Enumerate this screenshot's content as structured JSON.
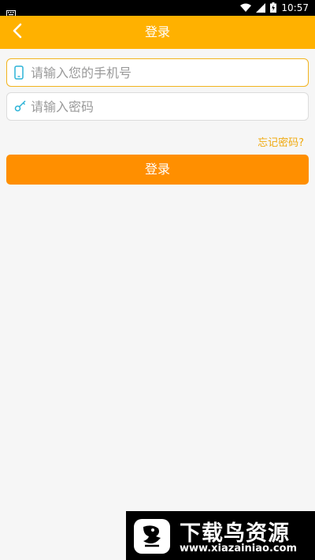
{
  "status_bar": {
    "time": "10:57",
    "icons": [
      "keyboard-icon",
      "wifi-icon",
      "signal-icon",
      "battery-charging-icon"
    ]
  },
  "app_bar": {
    "title": "登录",
    "back_icon": "chevron-left-icon"
  },
  "form": {
    "phone": {
      "placeholder": "请输入您的手机号",
      "value": "",
      "icon": "phone-icon",
      "focused": true
    },
    "password": {
      "placeholder": "请输入密码",
      "value": "",
      "icon": "key-icon"
    },
    "forgot_password": "忘记密码?",
    "submit_label": "登录"
  },
  "watermark": {
    "title": "下载鸟资源",
    "url": "www.xiazainiao.com"
  },
  "colors": {
    "app_bar": "#ffb100",
    "button": "#ff8f00",
    "link": "#f0a90e",
    "focus_border": "#f2b31d",
    "background": "#f6f6f6"
  }
}
